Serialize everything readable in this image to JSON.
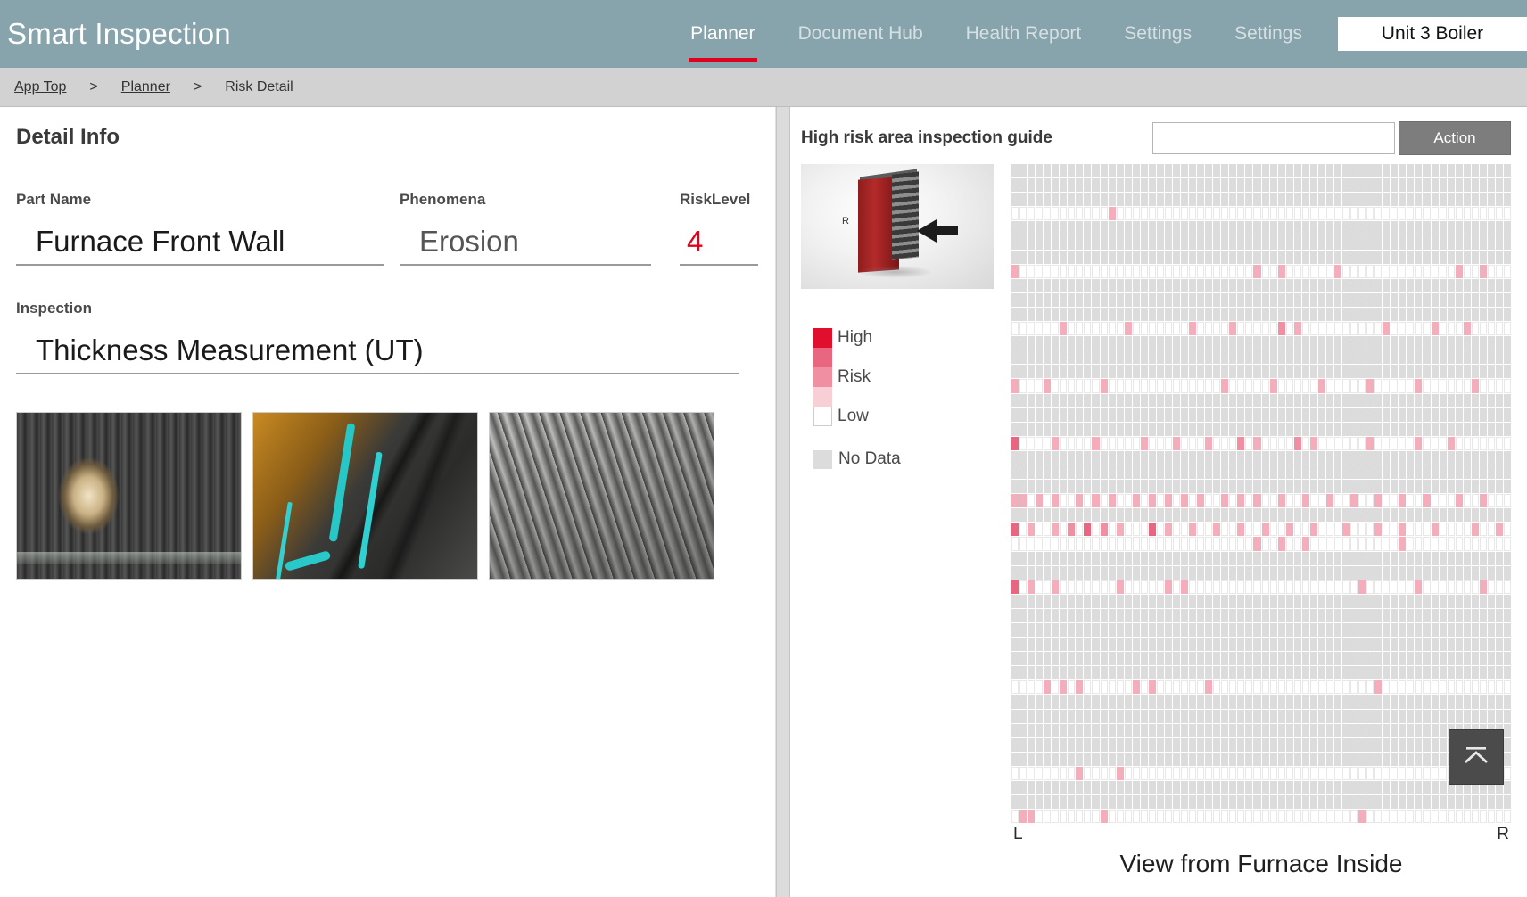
{
  "header": {
    "app_title": "Smart Inspection",
    "nav": [
      {
        "label": "Planner",
        "active": true
      },
      {
        "label": "Document Hub",
        "active": false
      },
      {
        "label": "Health Report",
        "active": false
      },
      {
        "label": "Settings",
        "active": false
      },
      {
        "label": "Settings",
        "active": false
      }
    ],
    "unit_selector": "Unit 3 Boiler",
    "bar_color": "#87a3ab",
    "active_underline_color": "#e00020"
  },
  "breadcrumb": {
    "items": [
      "App Top",
      "Planner",
      "Risk Detail"
    ],
    "separator": ">"
  },
  "detail": {
    "panel_title": "Detail Info",
    "part_name_label": "Part Name",
    "part_name_value": "Furnace Front Wall",
    "phenomena_label": "Phenomena",
    "phenomena_value": "Erosion",
    "risk_level_label": "RiskLevel",
    "risk_level_value": "4",
    "risk_level_color": "#e2001a",
    "inspection_label": "Inspection",
    "inspection_value": "Thickness Measurement (UT)",
    "photos": [
      {
        "name": "inspection-photo-1"
      },
      {
        "name": "inspection-photo-2"
      },
      {
        "name": "inspection-photo-3"
      }
    ]
  },
  "guide": {
    "title": "High risk area inspection guide",
    "search_value": "",
    "search_placeholder": "",
    "action_label": "Action",
    "diagram_label": "R",
    "legend": {
      "high_label": "High",
      "risk_label": "Risk",
      "low_label": "Low",
      "no_data_label": "No Data",
      "high_color": "#e10f2e",
      "mid_color": "#ef8fa1",
      "light_color": "#f9cfd6",
      "low_color": "#ffffff",
      "no_data_color": "#dcdcdc"
    },
    "axis_left": "L",
    "axis_right": "R",
    "caption": "View from Furnace Inside",
    "scroll_top_icon": "chevron-up-icon"
  },
  "chart_data": {
    "type": "heatmap",
    "title": "High risk area inspection guide",
    "xlabel": "",
    "ylabel": "",
    "x_tick_labels": [
      "L",
      "R"
    ],
    "caption": "View from Furnace Inside",
    "legend_position": "left",
    "columns": 62,
    "rows": 46,
    "value_scale": [
      "no-data",
      "low",
      "r1",
      "r2",
      "r3",
      "r4",
      "high"
    ],
    "color_map": {
      "no-data": "#dcdcdc",
      "low": "#ffffff",
      "r1": "#f9cfd6",
      "r2": "#f4aebb",
      "r3": "#ef8fa1",
      "r4": "#e8667f",
      "high": "#e10f2e"
    },
    "rows_data": [
      {
        "row": 0,
        "type": "nodata",
        "cells": []
      },
      {
        "row": 1,
        "type": "nodata",
        "cells": []
      },
      {
        "row": 2,
        "type": "nodata",
        "cells": []
      },
      {
        "row": 3,
        "type": "data",
        "cells": [
          [
            12,
            "r2"
          ]
        ]
      },
      {
        "row": 4,
        "type": "nodata",
        "cells": []
      },
      {
        "row": 5,
        "type": "nodata",
        "cells": []
      },
      {
        "row": 6,
        "type": "nodata",
        "cells": []
      },
      {
        "row": 7,
        "type": "data",
        "cells": [
          [
            0,
            "r2"
          ],
          [
            30,
            "r2"
          ],
          [
            33,
            "r2"
          ],
          [
            40,
            "r2"
          ],
          [
            55,
            "r2"
          ],
          [
            58,
            "r2"
          ]
        ]
      },
      {
        "row": 8,
        "type": "nodata",
        "cells": []
      },
      {
        "row": 9,
        "type": "nodata",
        "cells": []
      },
      {
        "row": 10,
        "type": "nodata",
        "cells": []
      },
      {
        "row": 11,
        "type": "data",
        "cells": [
          [
            6,
            "r2"
          ],
          [
            14,
            "r2"
          ],
          [
            22,
            "r2"
          ],
          [
            27,
            "r2"
          ],
          [
            33,
            "r3"
          ],
          [
            35,
            "r2"
          ],
          [
            46,
            "r2"
          ],
          [
            52,
            "r2"
          ],
          [
            56,
            "r2"
          ]
        ]
      },
      {
        "row": 12,
        "type": "nodata",
        "cells": []
      },
      {
        "row": 13,
        "type": "nodata",
        "cells": []
      },
      {
        "row": 14,
        "type": "nodata",
        "cells": []
      },
      {
        "row": 15,
        "type": "data",
        "cells": [
          [
            0,
            "r2"
          ],
          [
            4,
            "r2"
          ],
          [
            11,
            "r2"
          ],
          [
            26,
            "r2"
          ],
          [
            32,
            "r2"
          ],
          [
            38,
            "r2"
          ],
          [
            44,
            "r2"
          ],
          [
            50,
            "r2"
          ],
          [
            57,
            "r2"
          ]
        ]
      },
      {
        "row": 16,
        "type": "nodata",
        "cells": []
      },
      {
        "row": 17,
        "type": "nodata",
        "cells": []
      },
      {
        "row": 18,
        "type": "nodata",
        "cells": []
      },
      {
        "row": 19,
        "type": "data",
        "cells": [
          [
            0,
            "r4"
          ],
          [
            5,
            "r2"
          ],
          [
            10,
            "r2"
          ],
          [
            16,
            "r2"
          ],
          [
            20,
            "r2"
          ],
          [
            24,
            "r2"
          ],
          [
            28,
            "r3"
          ],
          [
            30,
            "r2"
          ],
          [
            35,
            "r3"
          ],
          [
            37,
            "r2"
          ],
          [
            44,
            "r2"
          ],
          [
            50,
            "r2"
          ],
          [
            54,
            "r2"
          ]
        ]
      },
      {
        "row": 20,
        "type": "nodata",
        "cells": []
      },
      {
        "row": 21,
        "type": "nodata",
        "cells": []
      },
      {
        "row": 22,
        "type": "nodata",
        "cells": []
      },
      {
        "row": 23,
        "type": "data",
        "cells": [
          [
            0,
            "r2"
          ],
          [
            1,
            "r2"
          ],
          [
            3,
            "r2"
          ],
          [
            5,
            "r2"
          ],
          [
            8,
            "r2"
          ],
          [
            10,
            "r2"
          ],
          [
            12,
            "r2"
          ],
          [
            15,
            "r2"
          ],
          [
            17,
            "r2"
          ],
          [
            19,
            "r2"
          ],
          [
            21,
            "r2"
          ],
          [
            23,
            "r2"
          ],
          [
            26,
            "r2"
          ],
          [
            28,
            "r2"
          ],
          [
            30,
            "r2"
          ],
          [
            33,
            "r2"
          ],
          [
            36,
            "r2"
          ],
          [
            39,
            "r2"
          ],
          [
            42,
            "r2"
          ],
          [
            45,
            "r2"
          ],
          [
            48,
            "r2"
          ],
          [
            51,
            "r2"
          ],
          [
            55,
            "r2"
          ],
          [
            58,
            "r2"
          ]
        ]
      },
      {
        "row": 24,
        "type": "nodata",
        "cells": []
      },
      {
        "row": 25,
        "type": "data",
        "cells": [
          [
            0,
            "r4"
          ],
          [
            2,
            "r2"
          ],
          [
            5,
            "r2"
          ],
          [
            7,
            "r3"
          ],
          [
            9,
            "r4"
          ],
          [
            11,
            "r3"
          ],
          [
            13,
            "r2"
          ],
          [
            17,
            "r4"
          ],
          [
            19,
            "r2"
          ],
          [
            22,
            "r2"
          ],
          [
            25,
            "r2"
          ],
          [
            28,
            "r2"
          ],
          [
            31,
            "r2"
          ],
          [
            34,
            "r2"
          ],
          [
            37,
            "r2"
          ],
          [
            41,
            "r2"
          ],
          [
            45,
            "r2"
          ],
          [
            48,
            "r2"
          ],
          [
            52,
            "r2"
          ],
          [
            57,
            "r2"
          ],
          [
            60,
            "r2"
          ]
        ]
      },
      {
        "row": 26,
        "type": "data",
        "cells": [
          [
            30,
            "r2"
          ],
          [
            33,
            "r2"
          ],
          [
            36,
            "r2"
          ],
          [
            48,
            "r2"
          ]
        ]
      },
      {
        "row": 27,
        "type": "nodata",
        "cells": []
      },
      {
        "row": 28,
        "type": "nodata",
        "cells": []
      },
      {
        "row": 29,
        "type": "data",
        "cells": [
          [
            0,
            "r4"
          ],
          [
            2,
            "r2"
          ],
          [
            5,
            "r2"
          ],
          [
            13,
            "r2"
          ],
          [
            19,
            "r2"
          ],
          [
            21,
            "r2"
          ],
          [
            43,
            "r2"
          ],
          [
            50,
            "r2"
          ],
          [
            58,
            "r2"
          ]
        ]
      },
      {
        "row": 30,
        "type": "nodata",
        "cells": []
      },
      {
        "row": 31,
        "type": "nodata",
        "cells": []
      },
      {
        "row": 32,
        "type": "nodata",
        "cells": []
      },
      {
        "row": 33,
        "type": "nodata",
        "cells": []
      },
      {
        "row": 34,
        "type": "nodata",
        "cells": []
      },
      {
        "row": 35,
        "type": "nodata",
        "cells": []
      },
      {
        "row": 36,
        "type": "data",
        "cells": [
          [
            4,
            "r2"
          ],
          [
            6,
            "r2"
          ],
          [
            8,
            "r2"
          ],
          [
            15,
            "r2"
          ],
          [
            17,
            "r2"
          ],
          [
            24,
            "r2"
          ],
          [
            45,
            "r2"
          ]
        ]
      },
      {
        "row": 37,
        "type": "nodata",
        "cells": []
      },
      {
        "row": 38,
        "type": "nodata",
        "cells": []
      },
      {
        "row": 39,
        "type": "nodata",
        "cells": []
      },
      {
        "row": 40,
        "type": "nodata",
        "cells": []
      },
      {
        "row": 41,
        "type": "nodata",
        "cells": []
      },
      {
        "row": 42,
        "type": "data",
        "cells": [
          [
            8,
            "r2"
          ],
          [
            13,
            "r2"
          ],
          [
            55,
            "r2"
          ]
        ]
      },
      {
        "row": 43,
        "type": "nodata",
        "cells": []
      },
      {
        "row": 44,
        "type": "nodata",
        "cells": []
      },
      {
        "row": 45,
        "type": "data",
        "cells": [
          [
            1,
            "r2"
          ],
          [
            2,
            "r2"
          ],
          [
            11,
            "r2"
          ],
          [
            43,
            "r2"
          ]
        ]
      }
    ]
  }
}
